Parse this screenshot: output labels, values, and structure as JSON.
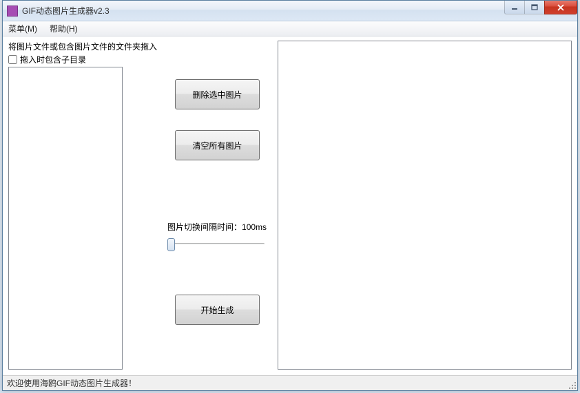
{
  "window": {
    "title": "GIF动态图片生成器v2.3"
  },
  "menu": {
    "menu_label": "菜单(M)",
    "help_label": "帮助(H)"
  },
  "left": {
    "drag_hint": "将图片文件或包含图片文件的文件夹拖入",
    "include_subdir_label": "拖入时包含子目录",
    "include_subdir_checked": false
  },
  "controls": {
    "delete_selected_label": "删除选中图片",
    "clear_all_label": "清空所有图片",
    "interval_label": "图片切换间隔时间：100ms",
    "start_label": "开始生成"
  },
  "status": {
    "text": "欢迎使用海鸥GIF动态图片生成器！"
  }
}
